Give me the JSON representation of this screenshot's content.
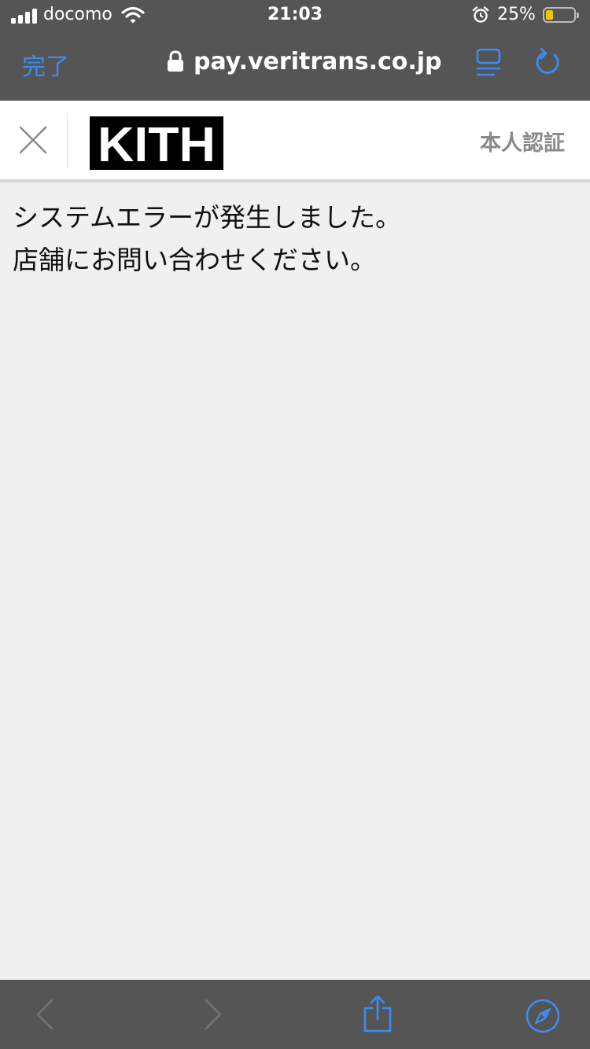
{
  "status_bar": {
    "carrier": "docomo",
    "time": "21:03",
    "battery_percent": "25%",
    "battery_level": 0.25,
    "icons": [
      "signal-bars-icon",
      "wifi-icon",
      "alarm-icon",
      "battery-icon"
    ]
  },
  "browser": {
    "done_label": "完了",
    "url": "pay.veritrans.co.jp",
    "icons": [
      "lock-icon",
      "reader-view-icon",
      "reload-icon"
    ],
    "accent_color": "#3b8cf0",
    "bar_color": "#555555"
  },
  "header": {
    "logo_text": "KITH",
    "title": "本人認証",
    "icons": [
      "close-icon"
    ]
  },
  "content": {
    "lines": [
      "システムエラーが発生しました。",
      "店舗にお問い合わせください。"
    ]
  },
  "toolbar": {
    "icons": [
      "back-icon",
      "forward-icon",
      "share-icon",
      "compass-icon"
    ]
  }
}
